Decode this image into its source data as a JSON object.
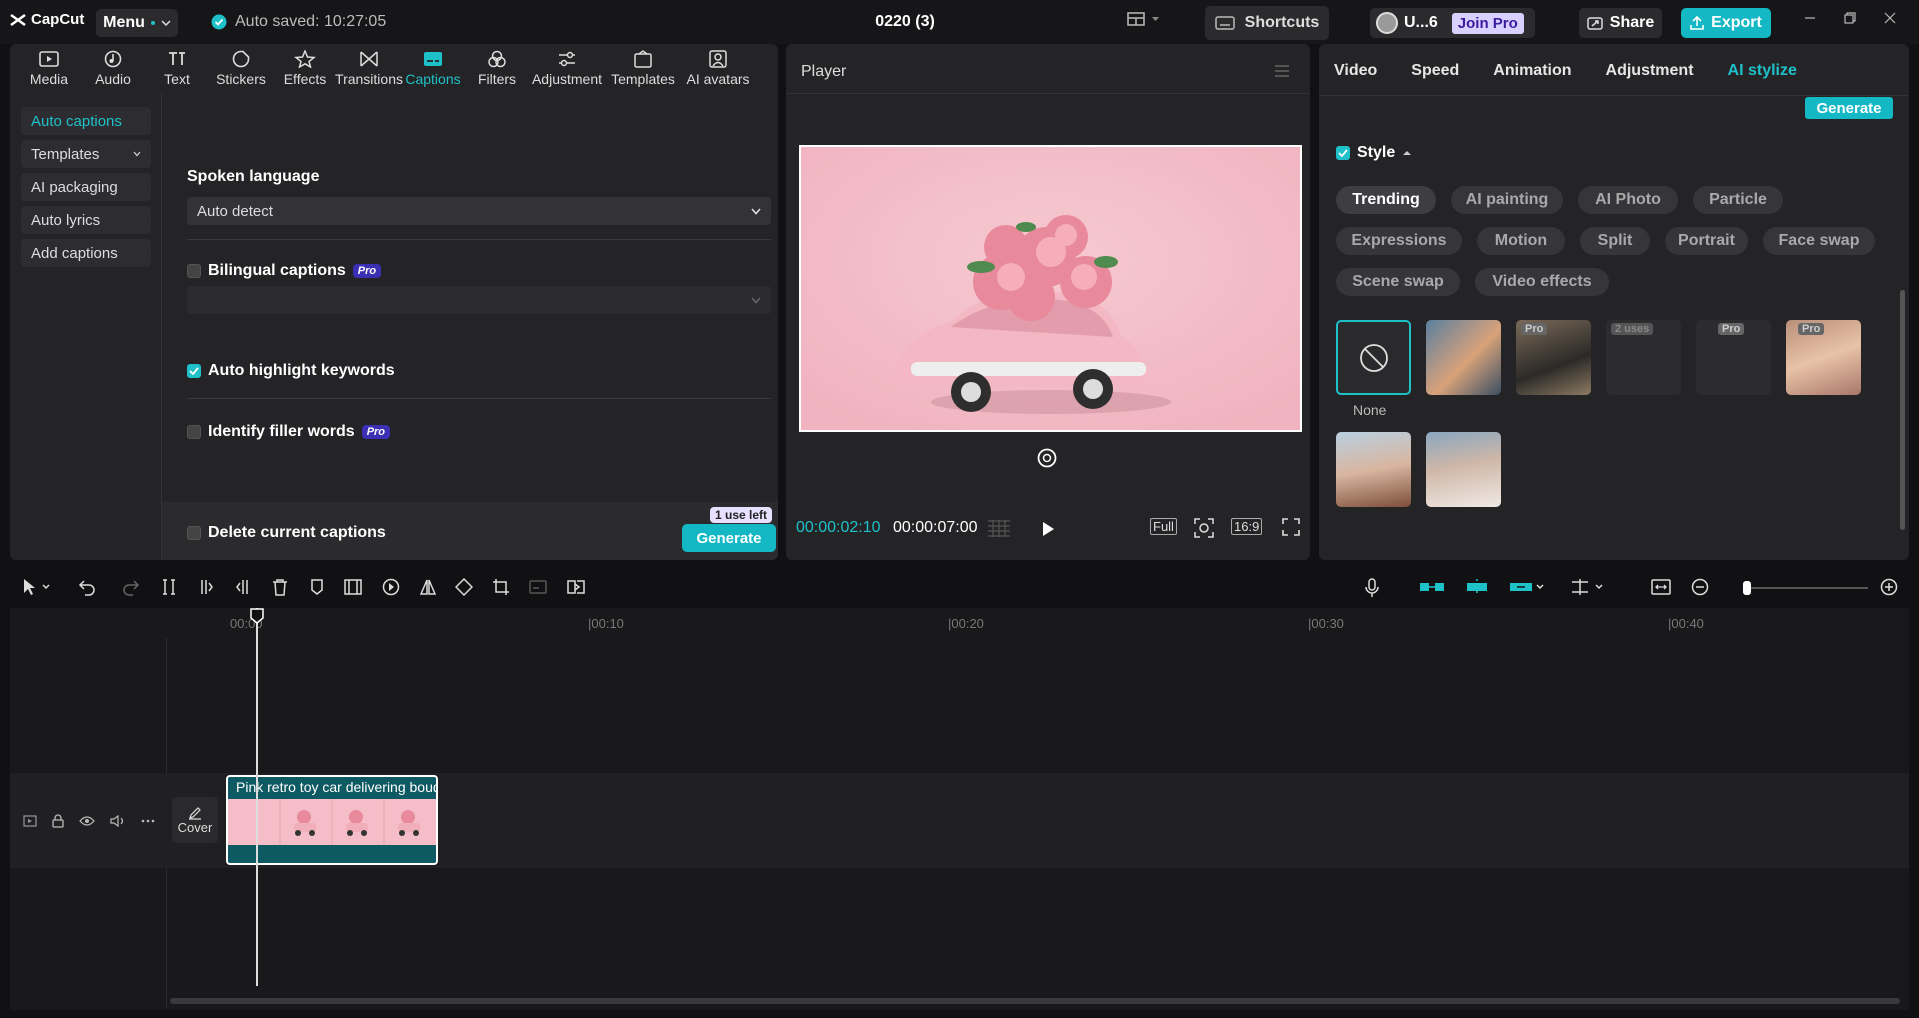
{
  "app": {
    "name": "CapCut",
    "menu_label": "Menu",
    "autosave": "Auto saved: 10:27:05",
    "project_title": "0220 (3)",
    "shortcuts": "Shortcuts",
    "user": "U...6",
    "join_pro": "Join Pro",
    "share": "Share",
    "export": "Export"
  },
  "tools": [
    {
      "label": "Media",
      "icon": "media-icon"
    },
    {
      "label": "Audio",
      "icon": "audio-icon"
    },
    {
      "label": "Text",
      "icon": "text-icon"
    },
    {
      "label": "Stickers",
      "icon": "stickers-icon"
    },
    {
      "label": "Effects",
      "icon": "effects-icon"
    },
    {
      "label": "Transitions",
      "icon": "transitions-icon"
    },
    {
      "label": "Captions",
      "icon": "captions-icon",
      "active": true
    },
    {
      "label": "Filters",
      "icon": "filters-icon"
    },
    {
      "label": "Adjustment",
      "icon": "adjustment-icon"
    },
    {
      "label": "Templates",
      "icon": "templates-icon"
    },
    {
      "label": "AI avatars",
      "icon": "ai-avatars-icon"
    }
  ],
  "sidenav": [
    "Auto captions",
    "Templates",
    "AI packaging",
    "Auto lyrics",
    "Add captions"
  ],
  "captions": {
    "spoken_language_label": "Spoken language",
    "spoken_language_value": "Auto detect",
    "bilingual_label": "Bilingual captions",
    "pro_label": "Pro",
    "auto_highlight_label": "Auto highlight keywords",
    "filler_label": "Identify filler words",
    "delete_label": "Delete current captions",
    "uses_left": "1 use left",
    "generate": "Generate"
  },
  "player": {
    "title": "Player",
    "current_time": "00:00:02:10",
    "total_time": "00:00:07:00",
    "full": "Full",
    "ratio": "16:9"
  },
  "right": {
    "tabs": [
      "Video",
      "Speed",
      "Animation",
      "Adjustment",
      "AI stylize"
    ],
    "generate": "Generate",
    "style_label": "Style",
    "chips": [
      "Trending",
      "AI painting",
      "AI Photo",
      "Particle",
      "Expressions",
      "Motion",
      "Split",
      "Portrait",
      "Face swap",
      "Scene swap",
      "Video effects"
    ],
    "none_label": "None",
    "badge_pro": "Pro",
    "badge_uses": "2 uses"
  },
  "timeline": {
    "ticks": [
      "00:00",
      "|00:10",
      "|00:20",
      "|00:30",
      "|00:40"
    ],
    "cover_label": "Cover",
    "clip_title": "Pink retro toy car delivering bouquet"
  },
  "colors": {
    "accent": "#1fc1c9",
    "panel": "#242427",
    "clip": "#0e5a62"
  }
}
